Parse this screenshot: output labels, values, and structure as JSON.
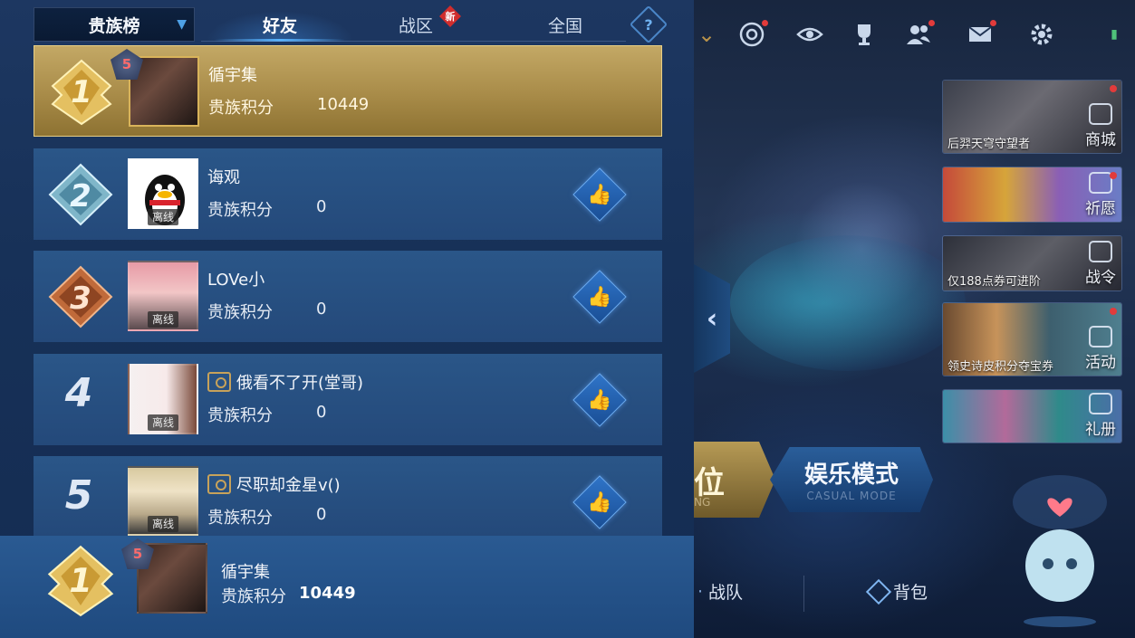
{
  "tabs": {
    "dropdown": "贵族榜",
    "friends": "好友",
    "region": "战区",
    "region_badge": "新",
    "nationwide": "全国",
    "help": "?"
  },
  "rows": [
    {
      "rank": "1",
      "level": "5",
      "name": "循宇集",
      "score_label": "贵族积分",
      "score": "10449",
      "status": ""
    },
    {
      "rank": "2",
      "level": "",
      "name": "诲观",
      "score_label": "贵族积分",
      "score": "0",
      "status": "离线"
    },
    {
      "rank": "3",
      "level": "",
      "name": "LOVe小",
      "score_label": "贵族积分",
      "score": "0",
      "status": "离线"
    },
    {
      "rank": "4",
      "level": "",
      "name": "俄看不了开(堂哥)",
      "score_label": "贵族积分",
      "score": "0",
      "status": "离线"
    },
    {
      "rank": "5",
      "level": "",
      "name": "尽职却金星v()",
      "score_label": "贵族积分",
      "score": "0",
      "status": "离线"
    }
  ],
  "me": {
    "rank": "1",
    "level": "5",
    "name": "循宇集",
    "score_label": "贵族积分",
    "score": "10449"
  },
  "promos": [
    {
      "caption": "后羿天穹守望者",
      "side": "商城"
    },
    {
      "caption": "",
      "side": "祈愿"
    },
    {
      "caption": "仅188点券可进阶",
      "side": "战令"
    },
    {
      "caption": "领史诗皮积分夺宝券",
      "side": "活动"
    },
    {
      "caption": "",
      "side": "礼册"
    }
  ],
  "modes": {
    "ranked": "位",
    "ranked_sub": "NG",
    "casual": "娱乐模式",
    "casual_sub": "CASUAL MODE"
  },
  "bottom_nav": {
    "team": "战队",
    "bag": "背包"
  },
  "colors": {
    "gold_row": "#c3a865",
    "row": "#2a5688",
    "accent": "#58b4ff",
    "red_dot": "#e23b3b"
  }
}
